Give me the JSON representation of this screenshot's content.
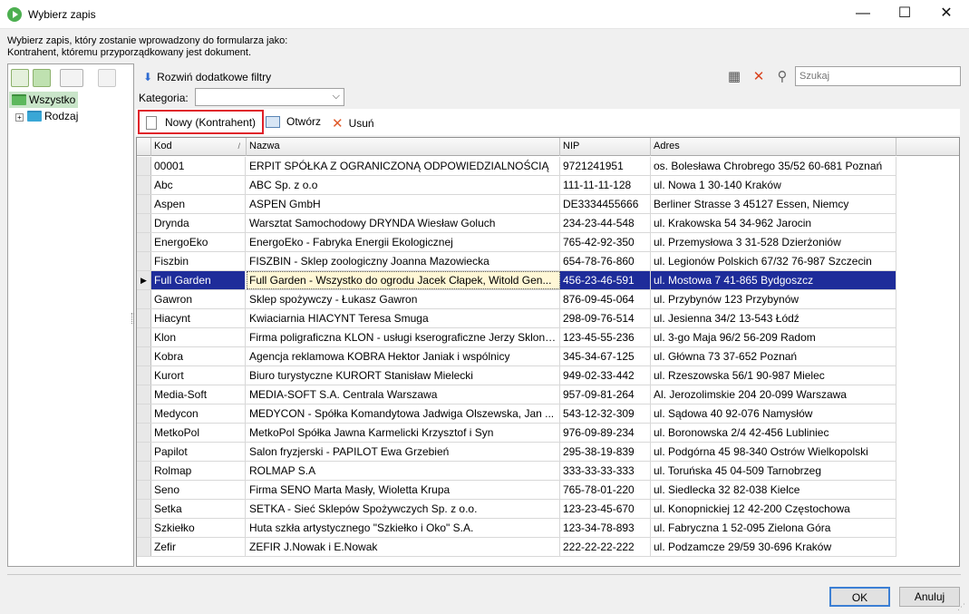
{
  "window": {
    "title": "Wybierz zapis",
    "minimize": "—",
    "maximize": "☐",
    "close": "✕"
  },
  "description": "Wybierz zapis, który zostanie wprowadzony do formularza jako:\nKontrahent, któremu przyporządkowany jest dokument.",
  "tree": {
    "items": [
      {
        "label": "Wszystko"
      },
      {
        "label": "Rodzaj"
      }
    ]
  },
  "filters": {
    "expand_label": "Rozwiń dodatkowe filtry",
    "search_placeholder": "Szukaj",
    "category_label": "Kategoria:",
    "category_value": ""
  },
  "actions": {
    "new_label": "Nowy (Kontrahent)",
    "open_label": "Otwórz",
    "delete_label": "Usuń"
  },
  "grid": {
    "columns": [
      "Kod",
      "Nazwa",
      "NIP",
      "Adres"
    ],
    "selected_index": 6,
    "rows": [
      [
        "00001",
        "ERPIT SPÓŁKA Z OGRANICZONĄ ODPOWIEDZIALNOŚCIĄ",
        "9721241951",
        "os. Bolesława Chrobrego 35/52 60-681 Poznań"
      ],
      [
        "Abc",
        "ABC Sp. z o.o",
        "111-11-11-128",
        "ul. Nowa 1 30-140 Kraków"
      ],
      [
        "Aspen",
        "ASPEN GmbH",
        "DE3334455666",
        "Berliner Strasse 3  45127 Essen, Niemcy"
      ],
      [
        "Drynda",
        "Warsztat Samochodowy DRYNDA Wiesław Goluch",
        "234-23-44-548",
        "ul. Krakowska 54 34-962 Jarocin"
      ],
      [
        "EnergoEko",
        "EnergoEko - Fabryka Energii Ekologicznej",
        "765-42-92-350",
        "ul. Przemysłowa 3 31-528 Dzierżoniów"
      ],
      [
        "Fiszbin",
        "FISZBIN - Sklep zoologiczny Joanna Mazowiecka",
        "654-78-76-860",
        "ul. Legionów Polskich 67/32 76-987 Szczecin"
      ],
      [
        "Full Garden",
        "Full Garden - Wszystko do ogrodu Jacek Cłapek, Witold Gen...",
        "456-23-46-591",
        "ul. Mostowa 7 41-865 Bydgoszcz"
      ],
      [
        "Gawron",
        "Sklep spożywczy - Łukasz Gawron",
        "876-09-45-064",
        "ul. Przybynów 123  Przybynów"
      ],
      [
        "Hiacynt",
        "Kwiaciarnia HIACYNT Teresa Smuga",
        "298-09-76-514",
        "ul. Jesienna 34/2 13-543 Łódź"
      ],
      [
        "Klon",
        "Firma poligraficzna KLON - usługi kserograficzne Jerzy Sklono...",
        "123-45-55-236",
        "ul. 3-go Maja 96/2 56-209 Radom"
      ],
      [
        "Kobra",
        "Agencja reklamowa KOBRA Hektor Janiak i wspólnicy",
        "345-34-67-125",
        "ul. Główna 73 37-652 Poznań"
      ],
      [
        "Kurort",
        "Biuro turystyczne KURORT Stanisław Mielecki",
        "949-02-33-442",
        "ul. Rzeszowska 56/1 90-987 Mielec"
      ],
      [
        "Media-Soft",
        "MEDIA-SOFT S.A. Centrala Warszawa",
        "957-09-81-264",
        "Al. Jerozolimskie 204 20-099 Warszawa"
      ],
      [
        "Medycon",
        "MEDYCON - Spółka Komandytowa Jadwiga Olszewska, Jan ...",
        "543-12-32-309",
        "ul. Sądowa 40 92-076 Namysłów"
      ],
      [
        "MetkoPol",
        "MetkoPol Spółka Jawna Karmelicki Krzysztof i Syn",
        "976-09-89-234",
        "ul. Boronowska 2/4 42-456 Lubliniec"
      ],
      [
        "Papilot",
        "Salon fryzjerski - PAPILOT Ewa Grzebień",
        "295-38-19-839",
        "ul. Podgórna 45 98-340 Ostrów Wielkopolski"
      ],
      [
        "Rolmap",
        "ROLMAP S.A",
        "333-33-33-333",
        "ul. Toruńska 45 04-509 Tarnobrzeg"
      ],
      [
        "Seno",
        "Firma SENO Marta Masły, Wioletta Krupa",
        "765-78-01-220",
        "ul. Siedlecka 32 82-038 Kielce"
      ],
      [
        "Setka",
        "SETKA - Sieć Sklepów Spożywczych Sp. z o.o.",
        "123-23-45-670",
        "ul. Konopnickiej 12 42-200 Częstochowa"
      ],
      [
        "Szkiełko",
        "Huta szkła artystycznego \"Szkiełko i Oko\" S.A.",
        "123-34-78-893",
        "ul. Fabryczna 1 52-095 Zielona Góra"
      ],
      [
        "Zefir",
        "ZEFIR J.Nowak i E.Nowak",
        "222-22-22-222",
        "ul. Podzamcze 29/59 30-696 Kraków"
      ]
    ]
  },
  "footer": {
    "ok_label": "OK",
    "cancel_label": "Anuluj"
  }
}
